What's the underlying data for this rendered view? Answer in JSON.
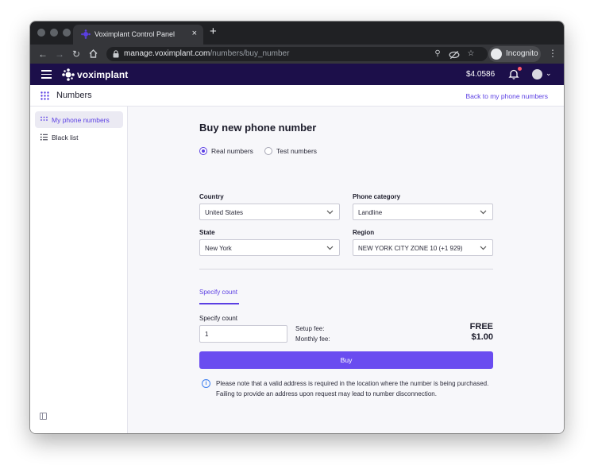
{
  "browser": {
    "tab_title": "Voximplant Control Panel",
    "tab_close": "×",
    "new_tab": "+",
    "url_host": "manage.voximplant.com",
    "url_path": "/numbers/buy_number",
    "incognito_label": "Incognito"
  },
  "header": {
    "logo_text": "voximplant",
    "balance": "$4.0586"
  },
  "subheader": {
    "title": "Numbers",
    "back_link": "Back to my phone numbers"
  },
  "sidebar": {
    "items": [
      {
        "label": "My phone numbers",
        "icon": "grid-icon",
        "active": true
      },
      {
        "label": "Black list",
        "icon": "list-icon",
        "active": false
      }
    ]
  },
  "main": {
    "title": "Buy new phone number",
    "number_types": [
      {
        "label": "Real numbers",
        "selected": true
      },
      {
        "label": "Test numbers",
        "selected": false
      }
    ],
    "country": {
      "label": "Country",
      "value": "United States"
    },
    "phone_category": {
      "label": "Phone category",
      "value": "Landline"
    },
    "state": {
      "label": "State",
      "value": "New York"
    },
    "region": {
      "label": "Region",
      "value": "NEW YORK CITY ZONE 10 (+1 929)"
    },
    "tab_specify_count": "Specify count",
    "count": {
      "label": "Specify count",
      "value": "1"
    },
    "setup_fee": {
      "label": "Setup fee:",
      "value": "FREE"
    },
    "monthly_fee": {
      "label": "Monthly fee:",
      "value": "$1.00"
    },
    "buy_label": "Buy",
    "notice": "Please note that a valid address is required in the location where the number is being purchased. Failing to provide an address upon request may lead to number disconnection."
  },
  "colors": {
    "accent": "#5b3fe3",
    "header_bg": "#1c0f4a",
    "button": "#6a4cf0"
  }
}
